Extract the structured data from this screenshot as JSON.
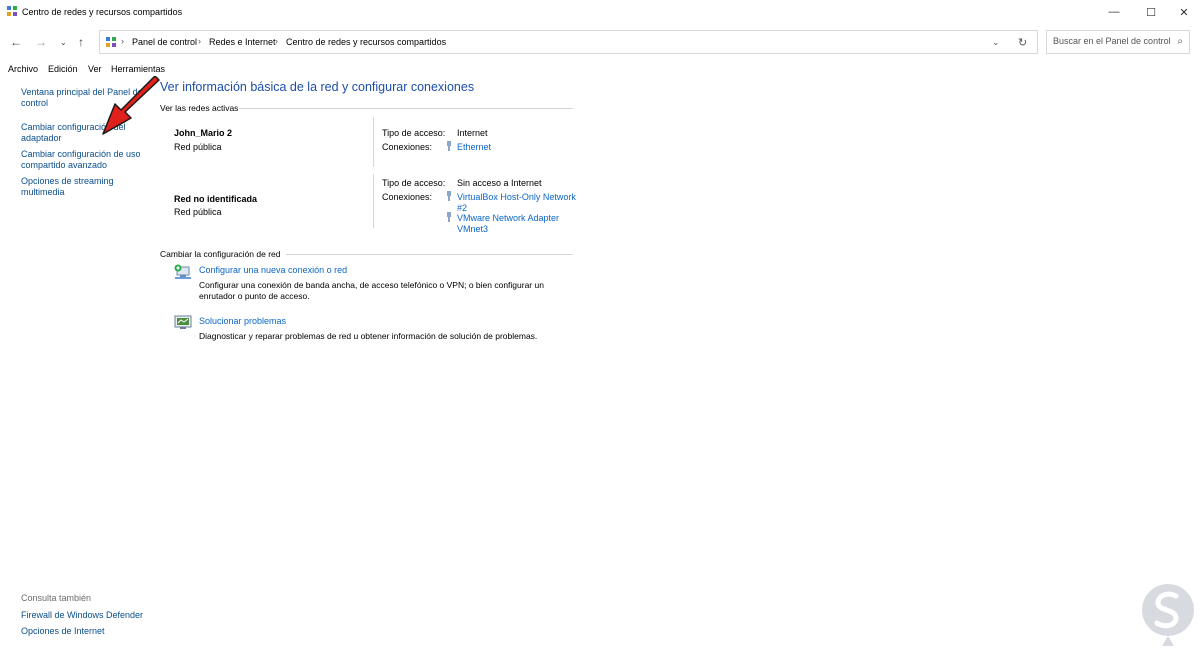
{
  "window": {
    "title": "Centro de redes y recursos compartidos",
    "controls": {
      "minimize": "—",
      "maximize": "☐",
      "close": "✕"
    }
  },
  "nav": {
    "back": "←",
    "forward": "→",
    "recent": "⌄",
    "up": "↑",
    "breadcrumbs": [
      "Panel de control",
      "Redes e Internet",
      "Centro de redes y recursos compartidos"
    ],
    "separator": "›",
    "dropdown": "⌄",
    "refresh": "↻",
    "search_placeholder": "Buscar en el Panel de control"
  },
  "menu": [
    "Archivo",
    "Edición",
    "Ver",
    "Herramientas"
  ],
  "sidebar": {
    "links": [
      "Ventana principal del Panel de control",
      "Cambiar configuración del adaptador",
      "Cambiar configuración de uso compartido avanzado",
      "Opciones de streaming multimedia"
    ],
    "see_also_title": "Consulta también",
    "see_also": [
      "Firewall de Windows Defender",
      "Opciones de Internet"
    ]
  },
  "main": {
    "title": "Ver información básica de la red y configurar conexiones",
    "active_networks_heading": "Ver las redes activas",
    "networks": [
      {
        "name": "John_Mario 2",
        "type": "Red pública",
        "access_label": "Tipo de acceso:",
        "access_value": "Internet",
        "connections_label": "Conexiones:",
        "connections": [
          "Ethernet"
        ]
      },
      {
        "name": "Red no identificada",
        "type": "Red pública",
        "access_label": "Tipo de acceso:",
        "access_value": "Sin acceso a Internet",
        "connections_label": "Conexiones:",
        "connections": [
          "VirtualBox Host-Only Network #2",
          "VMware Network Adapter VMnet3"
        ]
      }
    ],
    "change_heading": "Cambiar la configuración de red",
    "tasks": [
      {
        "link": "Configurar una nueva conexión o red",
        "description": "Configurar una conexión de banda ancha, de acceso telefónico o VPN; o bien configurar un enrutador o punto de acceso."
      },
      {
        "link": "Solucionar problemas",
        "description": "Diagnosticar y reparar problemas de red u obtener información de solución de problemas."
      }
    ]
  },
  "icons": {
    "app": "control-panel-icon",
    "plug": "network-plug-icon",
    "new_connection": "new-connection-icon",
    "troubleshoot": "troubleshoot-icon",
    "search": "search-icon"
  },
  "colors": {
    "link": "#0a66c8",
    "title": "#1d4ea8",
    "annotation_arrow": "#e0201b",
    "watermark": "#d7dbe0"
  }
}
